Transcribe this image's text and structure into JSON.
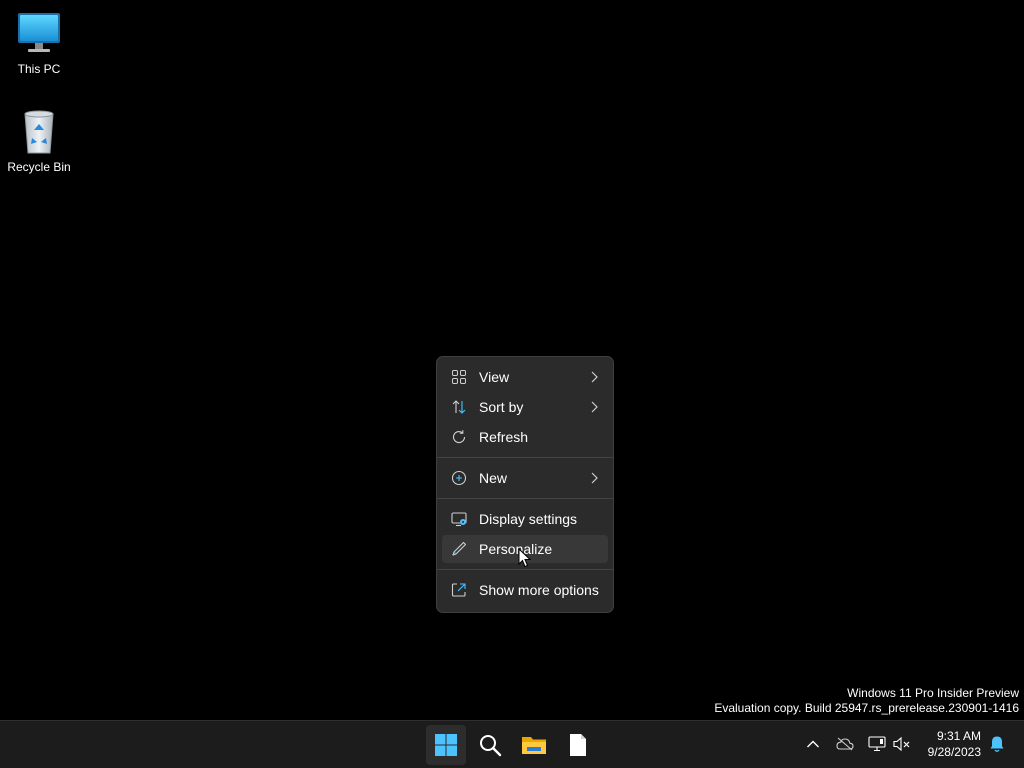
{
  "desktop": {
    "icons": [
      {
        "label": "This PC",
        "icon": "monitor-icon"
      },
      {
        "label": "Recycle Bin",
        "icon": "recycle-bin-icon"
      }
    ]
  },
  "context_menu": {
    "items": [
      {
        "label": "View",
        "icon": "grid-icon",
        "has_submenu": true
      },
      {
        "label": "Sort by",
        "icon": "sort-arrows-icon",
        "has_submenu": true
      },
      {
        "label": "Refresh",
        "icon": "refresh-icon",
        "has_submenu": false
      },
      {
        "label": "New",
        "icon": "plus-circle-icon",
        "has_submenu": true
      },
      {
        "label": "Display settings",
        "icon": "display-settings-icon",
        "has_submenu": false
      },
      {
        "label": "Personalize",
        "icon": "pen-icon",
        "has_submenu": false,
        "hovered": true
      },
      {
        "label": "Show more options",
        "icon": "share-icon",
        "has_submenu": false
      }
    ]
  },
  "watermark": {
    "line1": "Windows 11 Pro Insider Preview",
    "line2": "Evaluation copy. Build 25947.rs_prerelease.230901-1416"
  },
  "taskbar": {
    "pinned": [
      "start-icon",
      "search-icon",
      "file-explorer-icon",
      "notepad-icon"
    ],
    "tray": [
      "chevron-up-icon",
      "onedrive-icon",
      "network-icon",
      "volume-muted-icon"
    ],
    "clock": {
      "time": "9:31 AM",
      "date": "9/28/2023"
    }
  },
  "colors": {
    "accent": "#4cc2ff",
    "menu_bg": "#2b2b2b",
    "taskbar_bg": "#1c1c1c"
  }
}
